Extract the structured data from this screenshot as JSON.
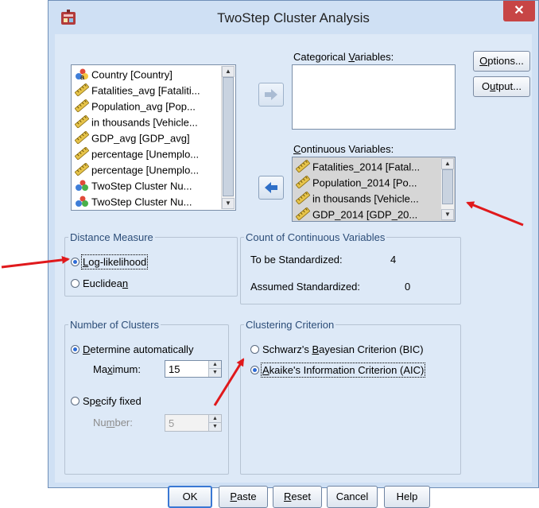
{
  "window": {
    "title": "TwoStep Cluster Analysis",
    "close_symbol": "✕"
  },
  "source_list": {
    "items": [
      {
        "label": "Country [Country]",
        "icon": "nominal-string-icon"
      },
      {
        "label": "Fatalities_avg [Fataliti...",
        "icon": "scale-ruler-icon"
      },
      {
        "label": "Population_avg [Pop...",
        "icon": "scale-ruler-icon"
      },
      {
        "label": "in thousands [Vehicle...",
        "icon": "scale-ruler-icon"
      },
      {
        "label": "GDP_avg [GDP_avg]",
        "icon": "scale-ruler-icon"
      },
      {
        "label": "percentage [Unemplo...",
        "icon": "scale-ruler-icon"
      },
      {
        "label": "percentage [Unemplo...",
        "icon": "scale-ruler-icon"
      },
      {
        "label": "TwoStep Cluster Nu...",
        "icon": "nominal-cluster-icon"
      },
      {
        "label": "TwoStep Cluster Nu...",
        "icon": "nominal-cluster-icon"
      }
    ]
  },
  "categorical": {
    "label_pre": "Categorical ",
    "label_mnemonic": "V",
    "label_post": "ariables:",
    "items": []
  },
  "continuous": {
    "label_mnemonic": "C",
    "label_post": "ontinuous Variables:",
    "items": [
      {
        "label": "Fatalities_2014 [Fatal...",
        "icon": "scale-ruler-icon"
      },
      {
        "label": "Population_2014 [Po...",
        "icon": "scale-ruler-icon"
      },
      {
        "label": "in thousands [Vehicle...",
        "icon": "scale-ruler-icon"
      },
      {
        "label": "GDP_2014 [GDP_20...",
        "icon": "scale-ruler-icon"
      }
    ]
  },
  "side_buttons": {
    "options": {
      "mnemonic": "O",
      "rest": "ptions..."
    },
    "output": {
      "pre": "O",
      "mnemonic": "u",
      "rest": "tput..."
    }
  },
  "distance_measure": {
    "legend": "Distance Measure",
    "loglik": {
      "mnemonic": "L",
      "rest": "og-likelihood",
      "selected": true
    },
    "euclid": {
      "pre": "Euclidea",
      "mnemonic": "n",
      "selected": false
    }
  },
  "count_continuous": {
    "legend": "Count of Continuous Variables",
    "to_be_label": "To be Standardized:",
    "to_be_value": "4",
    "assumed_label": "Assumed Standardized:",
    "assumed_value": "0"
  },
  "number_of_clusters": {
    "legend": "Number of Clusters",
    "auto": {
      "mnemonic": "D",
      "rest": "etermine automatically",
      "selected": true
    },
    "maximum": {
      "pre": "Ma",
      "mnemonic": "x",
      "rest": "imum:",
      "value": "15"
    },
    "fixed": {
      "pre": "Sp",
      "mnemonic": "e",
      "rest": "cify fixed",
      "selected": false
    },
    "number": {
      "pre": "Nu",
      "mnemonic": "m",
      "rest": "ber:",
      "value": "5"
    }
  },
  "clustering_criterion": {
    "legend": "Clustering Criterion",
    "bic": {
      "pre": "Schwarz's ",
      "mnemonic": "B",
      "rest": "ayesian Criterion (BIC)",
      "selected": false
    },
    "aic": {
      "mnemonic": "A",
      "rest": "kaike's Information Criterion (AIC)",
      "selected": true
    }
  },
  "bottom_buttons": {
    "ok": "OK",
    "paste": {
      "mnemonic": "P",
      "rest": "aste"
    },
    "reset": {
      "mnemonic": "R",
      "rest": "eset"
    },
    "cancel": "Cancel",
    "help": "Help"
  },
  "colors": {
    "dialog_bg": "#dde9f7",
    "close_red": "#c74545",
    "annotation_red": "#e0191c",
    "legend_blue": "#2c4d78"
  }
}
